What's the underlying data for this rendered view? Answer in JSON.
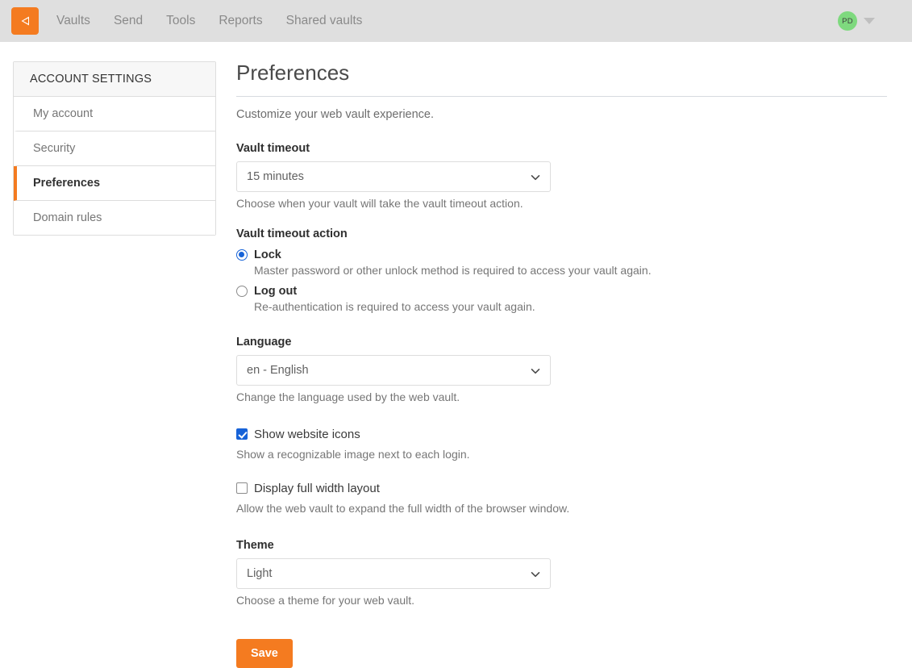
{
  "navbar": {
    "logo_icon": "bitwarden-shield-icon",
    "links": [
      {
        "label": "Vaults"
      },
      {
        "label": "Send"
      },
      {
        "label": "Tools"
      },
      {
        "label": "Reports"
      },
      {
        "label": "Shared vaults"
      }
    ],
    "avatar_initials": "PD",
    "avatar_color": "#7ed97e",
    "account_menu_icon": "chevron-down-icon"
  },
  "sidebar": {
    "header": "ACCOUNT SETTINGS",
    "items": [
      {
        "label": "My account",
        "active": false
      },
      {
        "label": "Security",
        "active": false
      },
      {
        "label": "Preferences",
        "active": true
      },
      {
        "label": "Domain rules",
        "active": false
      }
    ],
    "active_accent": "#f47b20"
  },
  "main": {
    "title": "Preferences",
    "subtitle": "Customize your web vault experience.",
    "vault_timeout": {
      "label": "Vault timeout",
      "value": "15 minutes",
      "help": "Choose when your vault will take the vault timeout action.",
      "options": [
        "15 minutes"
      ]
    },
    "vault_timeout_action": {
      "label": "Vault timeout action",
      "options": [
        {
          "label": "Lock",
          "description": "Master password or other unlock method is required to access your vault again.",
          "selected": true
        },
        {
          "label": "Log out",
          "description": "Re-authentication is required to access your vault again.",
          "selected": false
        }
      ]
    },
    "language": {
      "label": "Language",
      "value": "en - English",
      "help": "Change the language used by the web vault.",
      "options": [
        "en - English"
      ]
    },
    "show_website_icons": {
      "label": "Show website icons",
      "help": "Show a recognizable image next to each login.",
      "checked": true
    },
    "full_width_layout": {
      "label": "Display full width layout",
      "help": "Allow the web vault to expand the full width of the browser window.",
      "checked": false
    },
    "theme": {
      "label": "Theme",
      "value": "Light",
      "help": "Choose a theme for your web vault.",
      "options": [
        "Light"
      ]
    },
    "save_label": "Save",
    "save_color": "#f47b20"
  }
}
